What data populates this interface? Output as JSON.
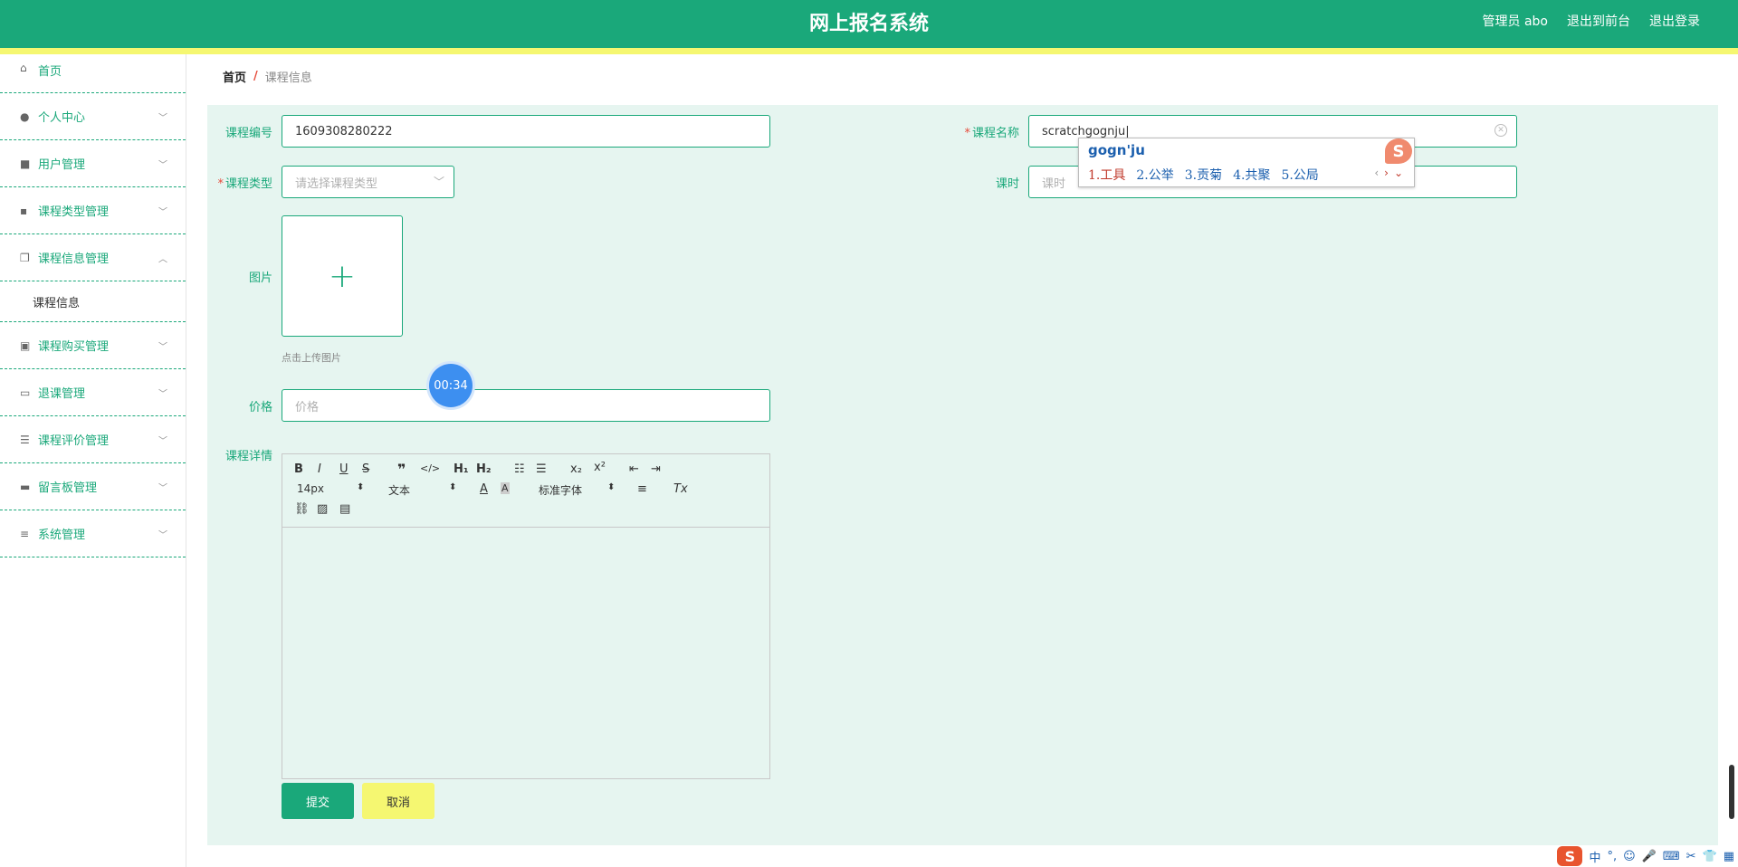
{
  "header": {
    "title": "网上报名系统",
    "links": [
      "管理员 abo",
      "退出到前台",
      "退出登录"
    ]
  },
  "sidebar": {
    "items": [
      {
        "label": "首页",
        "icon": "home-icon"
      },
      {
        "label": "个人中心",
        "icon": "person-icon"
      },
      {
        "label": "用户管理",
        "icon": "briefcase-icon"
      },
      {
        "label": "课程类型管理",
        "icon": "chat-icon"
      },
      {
        "label": "课程信息管理",
        "icon": "copy-icon"
      },
      {
        "label": "课程信息",
        "sub": true
      },
      {
        "label": "课程购买管理",
        "icon": "clipboard-icon"
      },
      {
        "label": "退课管理",
        "icon": "message-icon"
      },
      {
        "label": "课程评价管理",
        "icon": "list-icon"
      },
      {
        "label": "留言板管理",
        "icon": "suitcase-icon"
      },
      {
        "label": "系统管理",
        "icon": "sliders-icon"
      }
    ]
  },
  "breadcrumb": {
    "home": "首页",
    "sep": "/",
    "current": "课程信息"
  },
  "form": {
    "code_label": "课程编号",
    "code_value": "1609308280222",
    "name_label": "课程名称",
    "name_value": "scratchgognju",
    "type_label": "课程类型",
    "type_placeholder": "请选择课程类型",
    "hours_label": "课时",
    "hours_placeholder": "课时",
    "image_label": "图片",
    "upload_hint": "点击上传图片",
    "price_label": "价格",
    "price_placeholder": "价格",
    "detail_label": "课程详情"
  },
  "editor": {
    "font_size": "14px",
    "heading": "文本",
    "font_family": "标准字体"
  },
  "buttons": {
    "submit": "提交",
    "cancel": "取消"
  },
  "timer": "00:34",
  "ime": {
    "composition": "gogn'ju",
    "candidates": [
      "1.工具",
      "2.公举",
      "3.贡菊",
      "4.共聚",
      "5.公局"
    ]
  },
  "tray": {
    "lang": "中"
  },
  "colors": {
    "primary": "#1aa87a",
    "accent": "#f5f771",
    "panel": "#e6f5f0",
    "danger": "#e64b3b"
  }
}
